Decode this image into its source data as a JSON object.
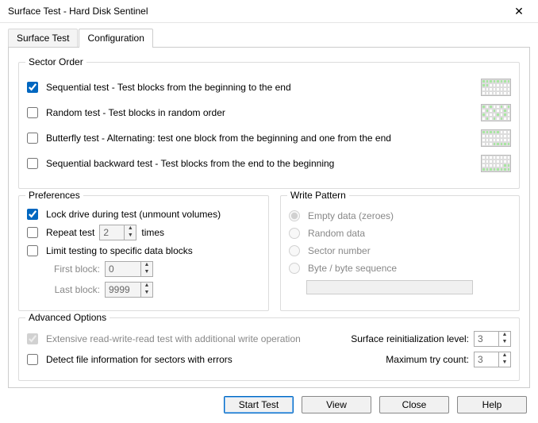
{
  "window": {
    "title": "Surface Test - Hard Disk Sentinel"
  },
  "tabs": {
    "surface": "Surface Test",
    "config": "Configuration"
  },
  "sectorOrder": {
    "legend": "Sector Order",
    "seq": "Sequential test - Test blocks from the beginning to the end",
    "rand": "Random test - Test blocks in random order",
    "butterfly": "Butterfly test - Alternating: test one block from the beginning and one from the end",
    "seqback": "Sequential backward test - Test blocks from the end to the beginning"
  },
  "prefs": {
    "legend": "Preferences",
    "lock": "Lock drive during test (unmount volumes)",
    "repeat": "Repeat test",
    "repeatCount": "2",
    "times": "times",
    "limit": "Limit testing to specific data blocks",
    "firstBlock": "First block:",
    "firstVal": "0",
    "lastBlock": "Last block:",
    "lastVal": "9999"
  },
  "wpat": {
    "legend": "Write Pattern",
    "empty": "Empty data (zeroes)",
    "random": "Random data",
    "sector": "Sector number",
    "byte": "Byte / byte sequence"
  },
  "adv": {
    "legend": "Advanced Options",
    "ext": "Extensive read-write-read test with additional write operation",
    "detect": "Detect file information for sectors with errors",
    "reinitLabel": "Surface reinitialization level:",
    "reinitVal": "3",
    "retryLabel": "Maximum try count:",
    "retryVal": "3"
  },
  "buttons": {
    "start": "Start Test",
    "view": "View",
    "close": "Close",
    "help": "Help"
  }
}
